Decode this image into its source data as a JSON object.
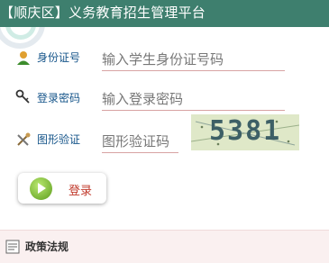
{
  "header": {
    "title": "【顺庆区】义务教育招生管理平台"
  },
  "form": {
    "id_number": {
      "label": "身份证号",
      "placeholder": "输入学生身份证号码"
    },
    "password": {
      "label": "登录密码",
      "placeholder": "输入登录密码"
    },
    "captcha": {
      "label": "图形验证",
      "placeholder": "图形验证码",
      "image_text": "5381"
    },
    "login_label": "登录"
  },
  "footer": {
    "policy_label": "政策法规"
  },
  "colors": {
    "header_bg": "#3e7f6e",
    "label_blue": "#16558a",
    "login_text": "#c0392b",
    "field_underline": "#d8a3a3"
  }
}
